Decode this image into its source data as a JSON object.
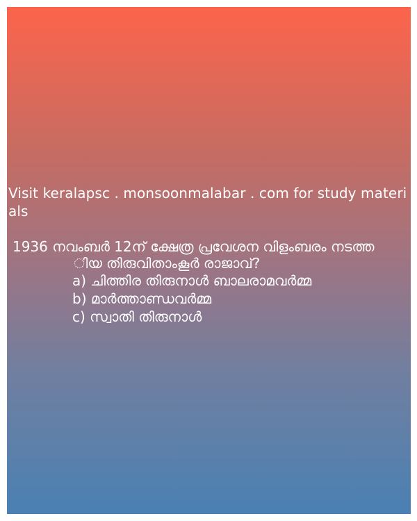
{
  "visit_text": "Visit keralapsc . monsoonmalabar . com for study materials",
  "question": {
    "line1": "1936 നവംബർ 12ന് ക്ഷേത്ര പ്രവേശന വിളംബരം നടത്ത",
    "line2": "ിയ തിരുവിതാംകൂർ രാജാവ്?"
  },
  "options": [
    "a) ചിത്തിര തിരുനാൾ ബാലരാമവർമ്മ",
    "b) മാർത്താണ്ഡവർമ്മ",
    "c) സ്വാതി തിരുനാൾ"
  ]
}
